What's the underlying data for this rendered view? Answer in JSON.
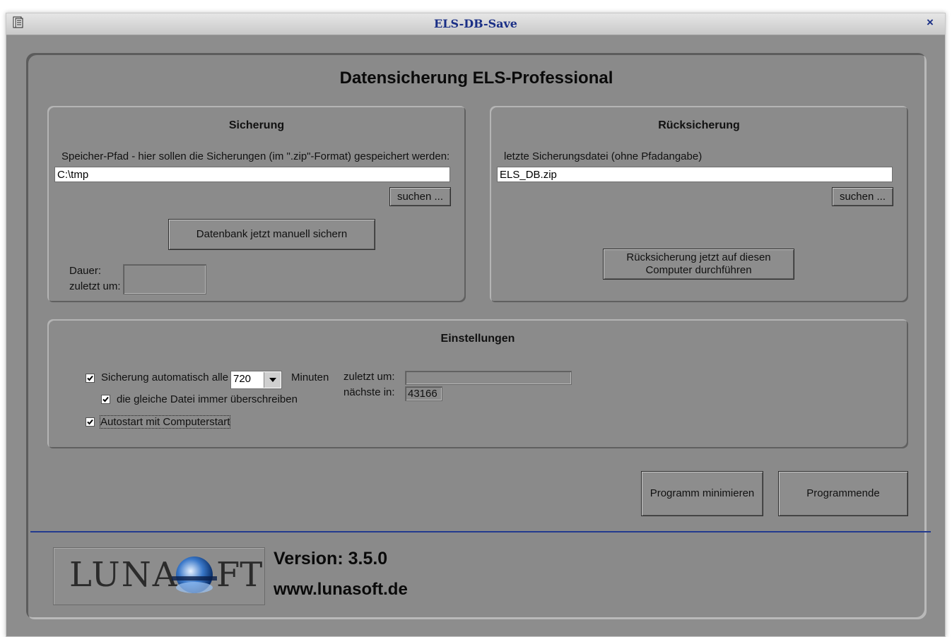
{
  "window": {
    "title": "ELS-DB-Save",
    "close": "×"
  },
  "main_title": "Datensicherung ELS-Professional",
  "sicherung": {
    "title": "Sicherung",
    "path_label": "Speicher-Pfad - hier sollen die Sicherungen (im \".zip\"-Format) gespeichert werden:",
    "path_value": "C:\\tmp",
    "browse": "suchen ...",
    "manual_backup": "Datenbank jetzt manuell sichern",
    "duration_label": "Dauer:",
    "last_label": "zuletzt um:"
  },
  "ruecksicherung": {
    "title": "Rücksicherung",
    "file_label": "letzte Sicherungsdatei (ohne Pfadangabe)",
    "file_value": "ELS_DB.zip",
    "browse": "suchen ...",
    "restore_line1": "Rücksicherung jetzt auf diesen",
    "restore_line2": "Computer durchführen"
  },
  "einstellungen": {
    "title": "Einstellungen",
    "auto_label": "Sicherung automatisch alle",
    "auto_checked": true,
    "interval": "720",
    "minutes": "Minuten",
    "overwrite_label": "die gleiche Datei immer überschreiben",
    "overwrite_checked": true,
    "autostart_label": "Autostart mit Computerstart",
    "autostart_checked": true,
    "last_label": "zuletzt um:",
    "last_value": "",
    "next_label": "nächste in:",
    "next_value": "43166"
  },
  "footer": {
    "minimize": "Programm minimieren",
    "exit": "Programmende",
    "version": "Version: 3.5.0",
    "url": "www.lunasoft.de",
    "logo_left": "LUNAS",
    "logo_right": "FT"
  },
  "colors": {
    "title_blue": "#1a2f86",
    "divider": "#233a8e",
    "background": "#8a8a8a"
  }
}
